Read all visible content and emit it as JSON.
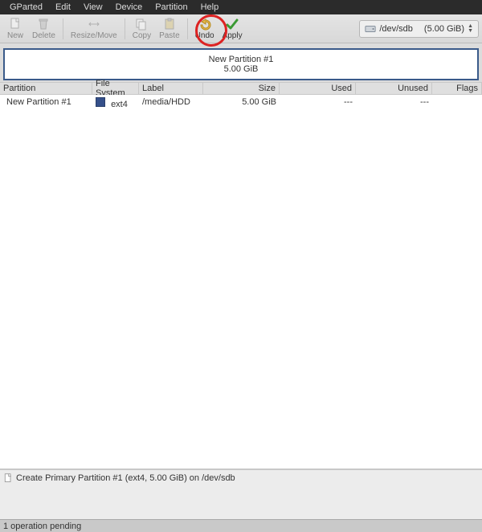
{
  "menu": {
    "items": [
      "GParted",
      "Edit",
      "View",
      "Device",
      "Partition",
      "Help"
    ]
  },
  "toolbar": {
    "new": "New",
    "delete": "Delete",
    "resize": "Resize/Move",
    "copy": "Copy",
    "paste": "Paste",
    "undo": "Undo",
    "apply": "Apply"
  },
  "device": {
    "path": "/dev/sdb",
    "size": "(5.00 GiB)"
  },
  "diagram": {
    "title": "New Partition #1",
    "size": "5.00 GiB"
  },
  "columns": {
    "partition": "Partition",
    "filesystem": "File System",
    "label": "Label",
    "size": "Size",
    "used": "Used",
    "unused": "Unused",
    "flags": "Flags"
  },
  "rows": [
    {
      "partition": "New Partition #1",
      "fs": "ext4",
      "label": "/media/HDD",
      "size": "5.00 GiB",
      "used": "---",
      "unused": "---",
      "flags": ""
    }
  ],
  "pending": {
    "item": "Create Primary Partition #1 (ext4, 5.00 GiB) on /dev/sdb"
  },
  "status": {
    "text": "1 operation pending"
  }
}
